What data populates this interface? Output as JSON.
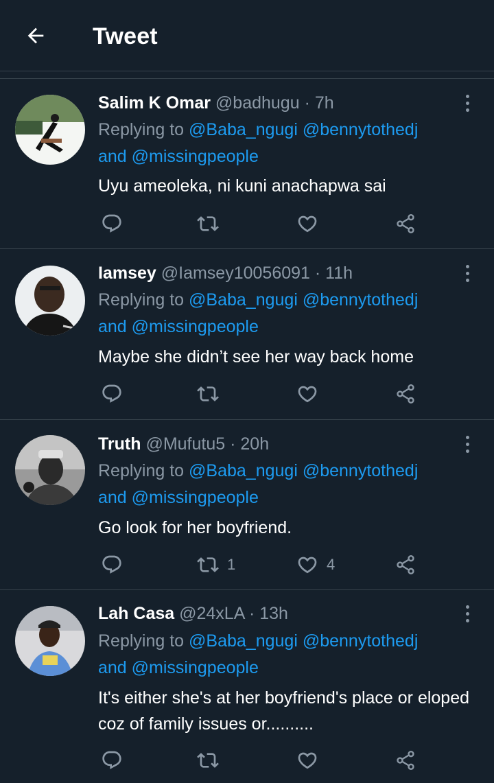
{
  "header": {
    "back_icon": "arrow-left-icon",
    "title": "Tweet"
  },
  "colors": {
    "background": "#15202b",
    "divider": "#38444d",
    "secondary_text": "#8b98a5",
    "link": "#1d9bf0"
  },
  "tweets": [
    {
      "name": "Salim K Omar",
      "handle": "@badhugu",
      "dot": "·",
      "time": "7h",
      "replying_label": "Replying to",
      "mention_1": "@Baba_ngugi",
      "mention_2": "@bennytothedj",
      "and_label": "and",
      "mention_3": "@missingpeople",
      "text": "Uyu ameoleka, ni kuni anachapwa sai",
      "retweet_count": "",
      "like_count": ""
    },
    {
      "name": "Iamsey",
      "handle": "@Iamsey10056091",
      "dot": "·",
      "time": "11h",
      "replying_label": "Replying to",
      "mention_1": "@Baba_ngugi",
      "mention_2": "@bennytothedj",
      "and_label": "and",
      "mention_3": "@missingpeople",
      "text": "Maybe she didn’t see her way back home",
      "retweet_count": "",
      "like_count": ""
    },
    {
      "name": "Truth",
      "handle": "@Mufutu5",
      "dot": "·",
      "time": "20h",
      "replying_label": "Replying to",
      "mention_1": "@Baba_ngugi",
      "mention_2": "@bennytothedj",
      "and_label": "and",
      "mention_3": "@missingpeople",
      "text": "Go look for her boyfriend.",
      "retweet_count": "1",
      "like_count": "4"
    },
    {
      "name": "Lah Casa",
      "handle": "@24xLA",
      "dot": "·",
      "time": "13h",
      "replying_label": "Replying to",
      "mention_1": "@Baba_ngugi",
      "mention_2": "@bennytothedj",
      "and_label": "and",
      "mention_3": "@missingpeople",
      "text": "It's either she's at her boyfriend's place or eloped coz of family issues or..........",
      "retweet_count": "",
      "like_count": ""
    }
  ],
  "icons": {
    "reply": "reply-icon",
    "retweet": "retweet-icon",
    "like": "like-icon",
    "share": "share-icon",
    "more": "more-vertical-icon"
  }
}
